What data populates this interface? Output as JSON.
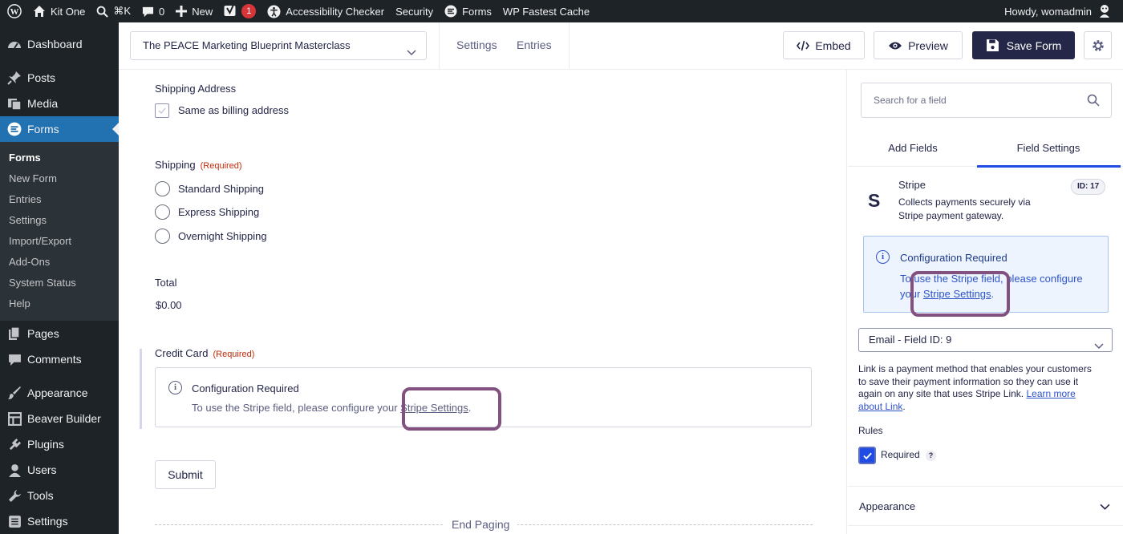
{
  "adminbar": {
    "site_name": "Kit One",
    "search_shortcut": "⌘K",
    "comments_count": "0",
    "new_label": "New",
    "yoast_badge": "1",
    "accessibility_label": "Accessibility Checker",
    "security_label": "Security",
    "forms_label": "Forms",
    "cache_label": "WP Fastest Cache",
    "greeting": "Howdy, womadmin"
  },
  "sidebar": {
    "items": [
      {
        "label": "Dashboard",
        "icon": "dashboard-icon"
      },
      {
        "label": "Posts",
        "icon": "pin-icon"
      },
      {
        "label": "Media",
        "icon": "media-icon"
      },
      {
        "label": "Forms",
        "icon": "forms-icon"
      }
    ],
    "submenu": [
      "Forms",
      "New Form",
      "Entries",
      "Settings",
      "Import/Export",
      "Add-Ons",
      "System Status",
      "Help"
    ],
    "items_after": [
      {
        "label": "Pages",
        "icon": "pages-icon"
      },
      {
        "label": "Comments",
        "icon": "comment-icon"
      },
      {
        "label": "Appearance",
        "icon": "brush-icon"
      },
      {
        "label": "Beaver Builder",
        "icon": "grid-icon"
      },
      {
        "label": "Plugins",
        "icon": "plug-icon"
      },
      {
        "label": "Users",
        "icon": "user-icon"
      },
      {
        "label": "Tools",
        "icon": "wrench-icon"
      },
      {
        "label": "Settings",
        "icon": "settings-icon"
      }
    ]
  },
  "toolbar": {
    "form_title": "The PEACE Marketing Blueprint Masterclass",
    "settings_label": "Settings",
    "entries_label": "Entries",
    "embed_label": "Embed",
    "preview_label": "Preview",
    "save_label": "Save Form"
  },
  "canvas": {
    "shipping_address_label": "Shipping Address",
    "same_as_billing": "Same as billing address",
    "shipping_label": "Shipping",
    "required_text": "(Required)",
    "shipping_options": [
      "Standard Shipping",
      "Express Shipping",
      "Overnight Shipping"
    ],
    "total_label": "Total",
    "total_value": "$0.00",
    "credit_card_label": "Credit Card",
    "notice_title": "Configuration Required",
    "notice_text": "To use the Stripe field, please configure your",
    "notice_link": "Stripe Settings",
    "period": ".",
    "submit_label": "Submit",
    "end_paging": "End Paging"
  },
  "panel": {
    "search_placeholder": "Search for a field",
    "tabs": [
      "Add Fields",
      "Field Settings"
    ],
    "field_name": "Stripe",
    "field_desc_1": "Collects payments securely via",
    "field_desc_2": "Stripe payment gateway.",
    "field_id": "ID: 17",
    "config_title": "Configuration Required",
    "config_text_1": "To use the Stripe field, please configure",
    "config_text_2": "your",
    "config_link": "Stripe Settings",
    "email_select": "Email - Field ID: 9",
    "link_desc_1": "Link is a payment method that enables your customers",
    "link_desc_2": "to save their payment information so they can use it",
    "link_desc_3": "again on any site that uses Stripe Link.",
    "learn_more": "Learn more",
    "about_link": "about Link",
    "rules_label": "Rules",
    "required_label": "Required",
    "help_mark": "?",
    "appearance_label": "Appearance"
  },
  "colors": {
    "adminbar": "#1d2327",
    "wp_blue": "#2271b1",
    "primary_button": "#242748",
    "highlight": "#82517f",
    "required_red": "#c02b0a",
    "link_blue": "#2f54c9",
    "active_tab_underline": "#204ce5"
  }
}
